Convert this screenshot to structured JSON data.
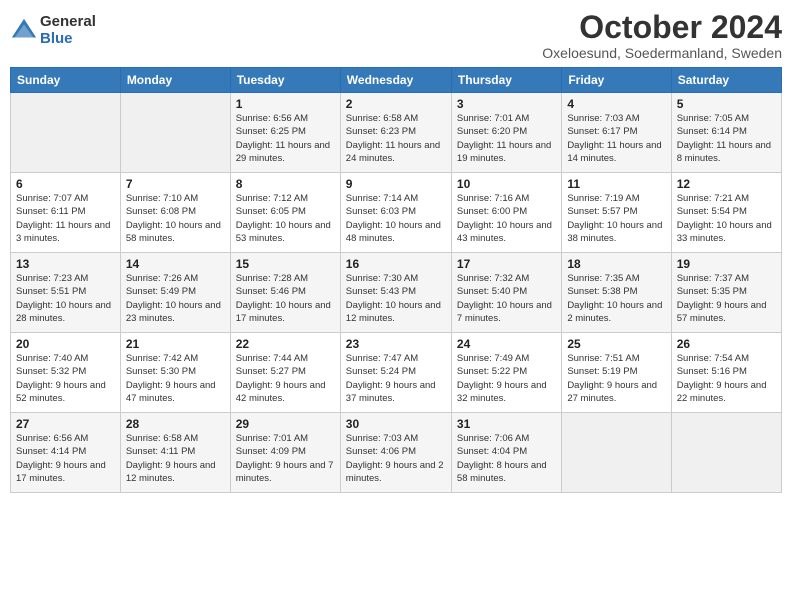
{
  "logo": {
    "general": "General",
    "blue": "Blue"
  },
  "title": "October 2024",
  "subtitle": "Oxeloesund, Soedermanland, Sweden",
  "days_of_week": [
    "Sunday",
    "Monday",
    "Tuesday",
    "Wednesday",
    "Thursday",
    "Friday",
    "Saturday"
  ],
  "weeks": [
    [
      {
        "day": "",
        "info": ""
      },
      {
        "day": "",
        "info": ""
      },
      {
        "day": "1",
        "info": "Sunrise: 6:56 AM\nSunset: 6:25 PM\nDaylight: 11 hours and 29 minutes."
      },
      {
        "day": "2",
        "info": "Sunrise: 6:58 AM\nSunset: 6:23 PM\nDaylight: 11 hours and 24 minutes."
      },
      {
        "day": "3",
        "info": "Sunrise: 7:01 AM\nSunset: 6:20 PM\nDaylight: 11 hours and 19 minutes."
      },
      {
        "day": "4",
        "info": "Sunrise: 7:03 AM\nSunset: 6:17 PM\nDaylight: 11 hours and 14 minutes."
      },
      {
        "day": "5",
        "info": "Sunrise: 7:05 AM\nSunset: 6:14 PM\nDaylight: 11 hours and 8 minutes."
      }
    ],
    [
      {
        "day": "6",
        "info": "Sunrise: 7:07 AM\nSunset: 6:11 PM\nDaylight: 11 hours and 3 minutes."
      },
      {
        "day": "7",
        "info": "Sunrise: 7:10 AM\nSunset: 6:08 PM\nDaylight: 10 hours and 58 minutes."
      },
      {
        "day": "8",
        "info": "Sunrise: 7:12 AM\nSunset: 6:05 PM\nDaylight: 10 hours and 53 minutes."
      },
      {
        "day": "9",
        "info": "Sunrise: 7:14 AM\nSunset: 6:03 PM\nDaylight: 10 hours and 48 minutes."
      },
      {
        "day": "10",
        "info": "Sunrise: 7:16 AM\nSunset: 6:00 PM\nDaylight: 10 hours and 43 minutes."
      },
      {
        "day": "11",
        "info": "Sunrise: 7:19 AM\nSunset: 5:57 PM\nDaylight: 10 hours and 38 minutes."
      },
      {
        "day": "12",
        "info": "Sunrise: 7:21 AM\nSunset: 5:54 PM\nDaylight: 10 hours and 33 minutes."
      }
    ],
    [
      {
        "day": "13",
        "info": "Sunrise: 7:23 AM\nSunset: 5:51 PM\nDaylight: 10 hours and 28 minutes."
      },
      {
        "day": "14",
        "info": "Sunrise: 7:26 AM\nSunset: 5:49 PM\nDaylight: 10 hours and 23 minutes."
      },
      {
        "day": "15",
        "info": "Sunrise: 7:28 AM\nSunset: 5:46 PM\nDaylight: 10 hours and 17 minutes."
      },
      {
        "day": "16",
        "info": "Sunrise: 7:30 AM\nSunset: 5:43 PM\nDaylight: 10 hours and 12 minutes."
      },
      {
        "day": "17",
        "info": "Sunrise: 7:32 AM\nSunset: 5:40 PM\nDaylight: 10 hours and 7 minutes."
      },
      {
        "day": "18",
        "info": "Sunrise: 7:35 AM\nSunset: 5:38 PM\nDaylight: 10 hours and 2 minutes."
      },
      {
        "day": "19",
        "info": "Sunrise: 7:37 AM\nSunset: 5:35 PM\nDaylight: 9 hours and 57 minutes."
      }
    ],
    [
      {
        "day": "20",
        "info": "Sunrise: 7:40 AM\nSunset: 5:32 PM\nDaylight: 9 hours and 52 minutes."
      },
      {
        "day": "21",
        "info": "Sunrise: 7:42 AM\nSunset: 5:30 PM\nDaylight: 9 hours and 47 minutes."
      },
      {
        "day": "22",
        "info": "Sunrise: 7:44 AM\nSunset: 5:27 PM\nDaylight: 9 hours and 42 minutes."
      },
      {
        "day": "23",
        "info": "Sunrise: 7:47 AM\nSunset: 5:24 PM\nDaylight: 9 hours and 37 minutes."
      },
      {
        "day": "24",
        "info": "Sunrise: 7:49 AM\nSunset: 5:22 PM\nDaylight: 9 hours and 32 minutes."
      },
      {
        "day": "25",
        "info": "Sunrise: 7:51 AM\nSunset: 5:19 PM\nDaylight: 9 hours and 27 minutes."
      },
      {
        "day": "26",
        "info": "Sunrise: 7:54 AM\nSunset: 5:16 PM\nDaylight: 9 hours and 22 minutes."
      }
    ],
    [
      {
        "day": "27",
        "info": "Sunrise: 6:56 AM\nSunset: 4:14 PM\nDaylight: 9 hours and 17 minutes."
      },
      {
        "day": "28",
        "info": "Sunrise: 6:58 AM\nSunset: 4:11 PM\nDaylight: 9 hours and 12 minutes."
      },
      {
        "day": "29",
        "info": "Sunrise: 7:01 AM\nSunset: 4:09 PM\nDaylight: 9 hours and 7 minutes."
      },
      {
        "day": "30",
        "info": "Sunrise: 7:03 AM\nSunset: 4:06 PM\nDaylight: 9 hours and 2 minutes."
      },
      {
        "day": "31",
        "info": "Sunrise: 7:06 AM\nSunset: 4:04 PM\nDaylight: 8 hours and 58 minutes."
      },
      {
        "day": "",
        "info": ""
      },
      {
        "day": "",
        "info": ""
      }
    ]
  ]
}
